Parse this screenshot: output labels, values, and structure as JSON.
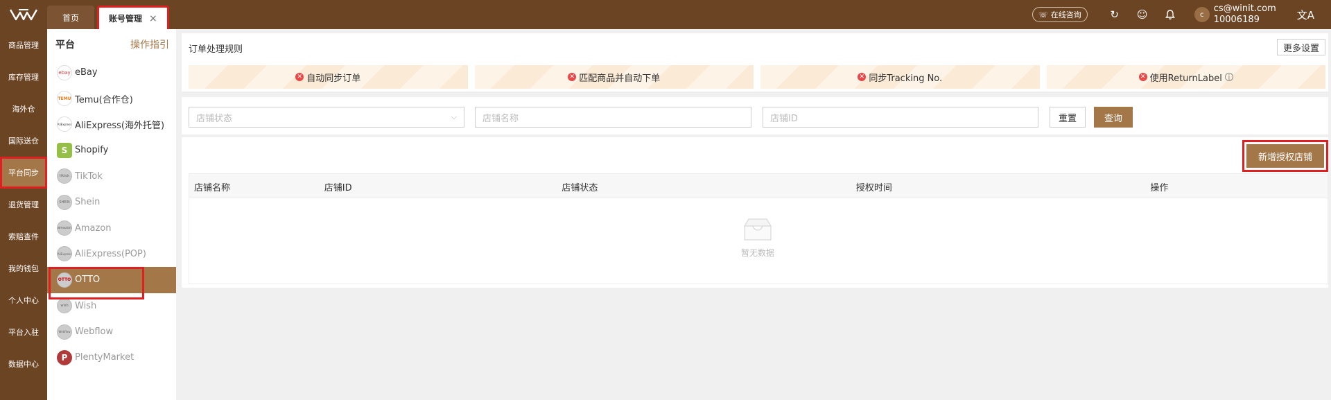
{
  "topbar": {
    "tabs": [
      {
        "label": "首页"
      },
      {
        "label": "账号管理",
        "close": "×"
      }
    ],
    "consult_label": "在线咨询",
    "user": {
      "avatar": "c",
      "email": "cs@winit.com",
      "id": "10006189"
    },
    "icons": [
      "refresh-icon",
      "smile-icon",
      "bell-icon",
      "translate-icon"
    ]
  },
  "leftnav": {
    "items": [
      {
        "label": "商品管理"
      },
      {
        "label": "库存管理"
      },
      {
        "label": "海外仓"
      },
      {
        "label": "国际送仓"
      },
      {
        "label": "平台同步",
        "active": true
      },
      {
        "label": "退货管理"
      },
      {
        "label": "索赔查件"
      },
      {
        "label": "我的钱包"
      },
      {
        "label": "个人中心"
      },
      {
        "label": "平台入驻"
      },
      {
        "label": "数据中心"
      }
    ]
  },
  "platforms": {
    "title": "平台",
    "guide": "操作指引",
    "items": [
      {
        "label": "eBay",
        "icon": "ebay",
        "dim": false
      },
      {
        "label": "Temu(合作仓)",
        "icon": "TEMU",
        "dim": false
      },
      {
        "label": "AliExpress(海外托管)",
        "icon": "AliExpress",
        "dim": false
      },
      {
        "label": "Shopify",
        "icon": "S",
        "dim": false
      },
      {
        "label": "TikTok",
        "icon": "tiktok",
        "dim": true
      },
      {
        "label": "Shein",
        "icon": "SHEIN",
        "dim": true
      },
      {
        "label": "Amazon",
        "icon": "amazon",
        "dim": true
      },
      {
        "label": "AliExpress(POP)",
        "icon": "AliExpress",
        "dim": true
      },
      {
        "label": "OTTO",
        "icon": "OTTO",
        "dim": false,
        "active": true
      },
      {
        "label": "Wish",
        "icon": "wish",
        "dim": true
      },
      {
        "label": "Webflow",
        "icon": "Webflow",
        "dim": true
      },
      {
        "label": "PlentyMarket",
        "icon": "P",
        "dim": true
      }
    ]
  },
  "rules": {
    "title": "订单处理规则",
    "more_settings": "更多设置",
    "items": [
      {
        "label": "自动同步订单",
        "info": false
      },
      {
        "label": "匹配商品并自动下单",
        "info": false
      },
      {
        "label": "同步Tracking No.",
        "info": false
      },
      {
        "label": "使用ReturnLabel",
        "info": true
      }
    ]
  },
  "filters": {
    "status_placeholder": "店铺状态",
    "name_placeholder": "店铺名称",
    "id_placeholder": "店铺ID",
    "reset": "重置",
    "query": "查询"
  },
  "table": {
    "add_button": "新增授权店铺",
    "columns": [
      "店铺名称",
      "店铺ID",
      "店铺状态",
      "授权时间",
      "操作"
    ],
    "empty_text": "暂无数据"
  },
  "colors": {
    "brand_dark": "#6b4423",
    "brand_accent": "#a37748",
    "highlight_border": "#e02020"
  }
}
